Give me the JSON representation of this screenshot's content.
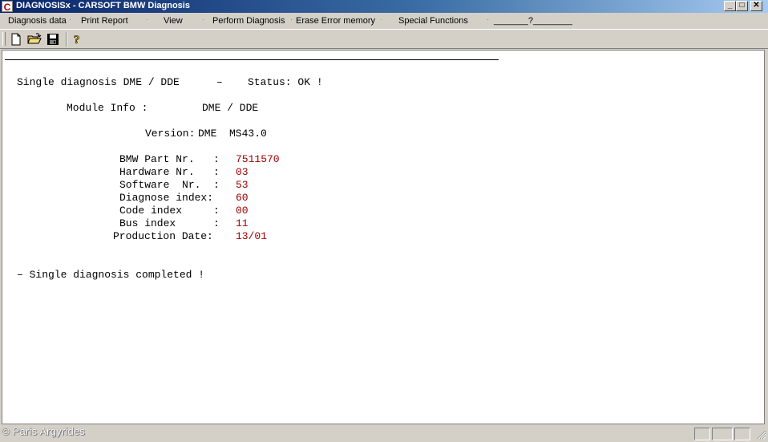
{
  "window": {
    "app_icon": "C",
    "title": "DIAGNOSISx - CARSOFT BMW Diagnosis",
    "controls": {
      "minimize": "_",
      "maximize": "□",
      "close": "✕"
    }
  },
  "menu": {
    "items": [
      "Diagnosis data",
      "Print Report",
      "View",
      "Perform Diagnosis",
      "Erase Error memory",
      "Special Functions",
      "_______?________"
    ],
    "separator": "·"
  },
  "toolbar": {
    "buttons": [
      "new-file-icon",
      "open-folder-icon",
      "save-disk-icon",
      "help-icon"
    ]
  },
  "report": {
    "heading_left": "Single diagnosis DME / DDE",
    "heading_dash": "–",
    "status_label": "Status: OK !",
    "module_info_label": "Module Info :",
    "module_info_value": "DME / DDE",
    "version_label": "Version:",
    "version_value": "DME  MS43.0",
    "fields": [
      {
        "label": "BMW Part Nr.   :",
        "value": "7511570"
      },
      {
        "label": "Hardware Nr.   :",
        "value": "03"
      },
      {
        "label": "Software  Nr.  :",
        "value": "53"
      },
      {
        "label": "Diagnose index:",
        "value": "60"
      },
      {
        "label": "Code index     :",
        "value": "00"
      },
      {
        "label": "Bus index      :",
        "value": "11"
      },
      {
        "label": "Production Date:",
        "value": "13/01"
      }
    ],
    "completion": "– Single diagnosis completed !"
  },
  "statusbar": {
    "watermark": "© Paris Argyrides"
  }
}
